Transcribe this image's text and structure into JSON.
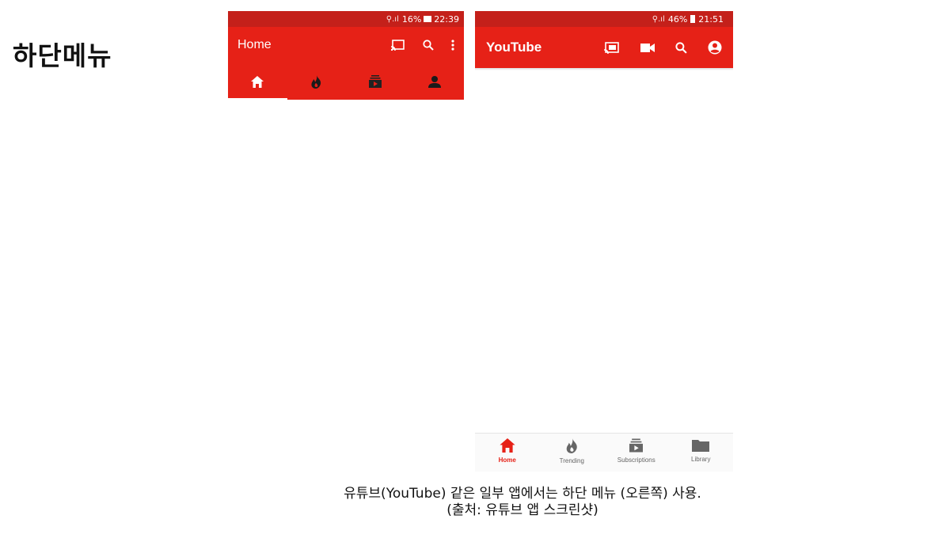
{
  "slide": {
    "title": "하단메뉴"
  },
  "left_phone": {
    "status_bar": {
      "signal": "⚲.ıl",
      "battery": "16%",
      "time": "22:39"
    },
    "app_bar": {
      "title": "Home"
    },
    "tab_icons": [
      "home-icon",
      "trending-icon",
      "subscriptions-icon",
      "account-icon"
    ],
    "active_tab": 0
  },
  "right_phone": {
    "status_bar": {
      "signal": "⚲.ıl",
      "battery": "46%",
      "time": "21:51"
    },
    "app_bar": {
      "title": "YouTube"
    },
    "bottom_nav": [
      {
        "label": "Home",
        "icon": "home-icon"
      },
      {
        "label": "Trending",
        "icon": "trending-icon"
      },
      {
        "label": "Subscriptions",
        "icon": "subscriptions-icon"
      },
      {
        "label": "Library",
        "icon": "library-icon"
      }
    ],
    "active_nav": 0
  },
  "caption": {
    "line1": "유튜브(YouTube) 같은 일부 앱에서는 하단 메뉴 (오른쪽) 사용.",
    "line2": "(출처: 유튜브 앱 스크린샷)"
  },
  "colors": {
    "brand_red": "#e62117",
    "status_red": "#c4201a",
    "inactive_gray": "#666666"
  }
}
